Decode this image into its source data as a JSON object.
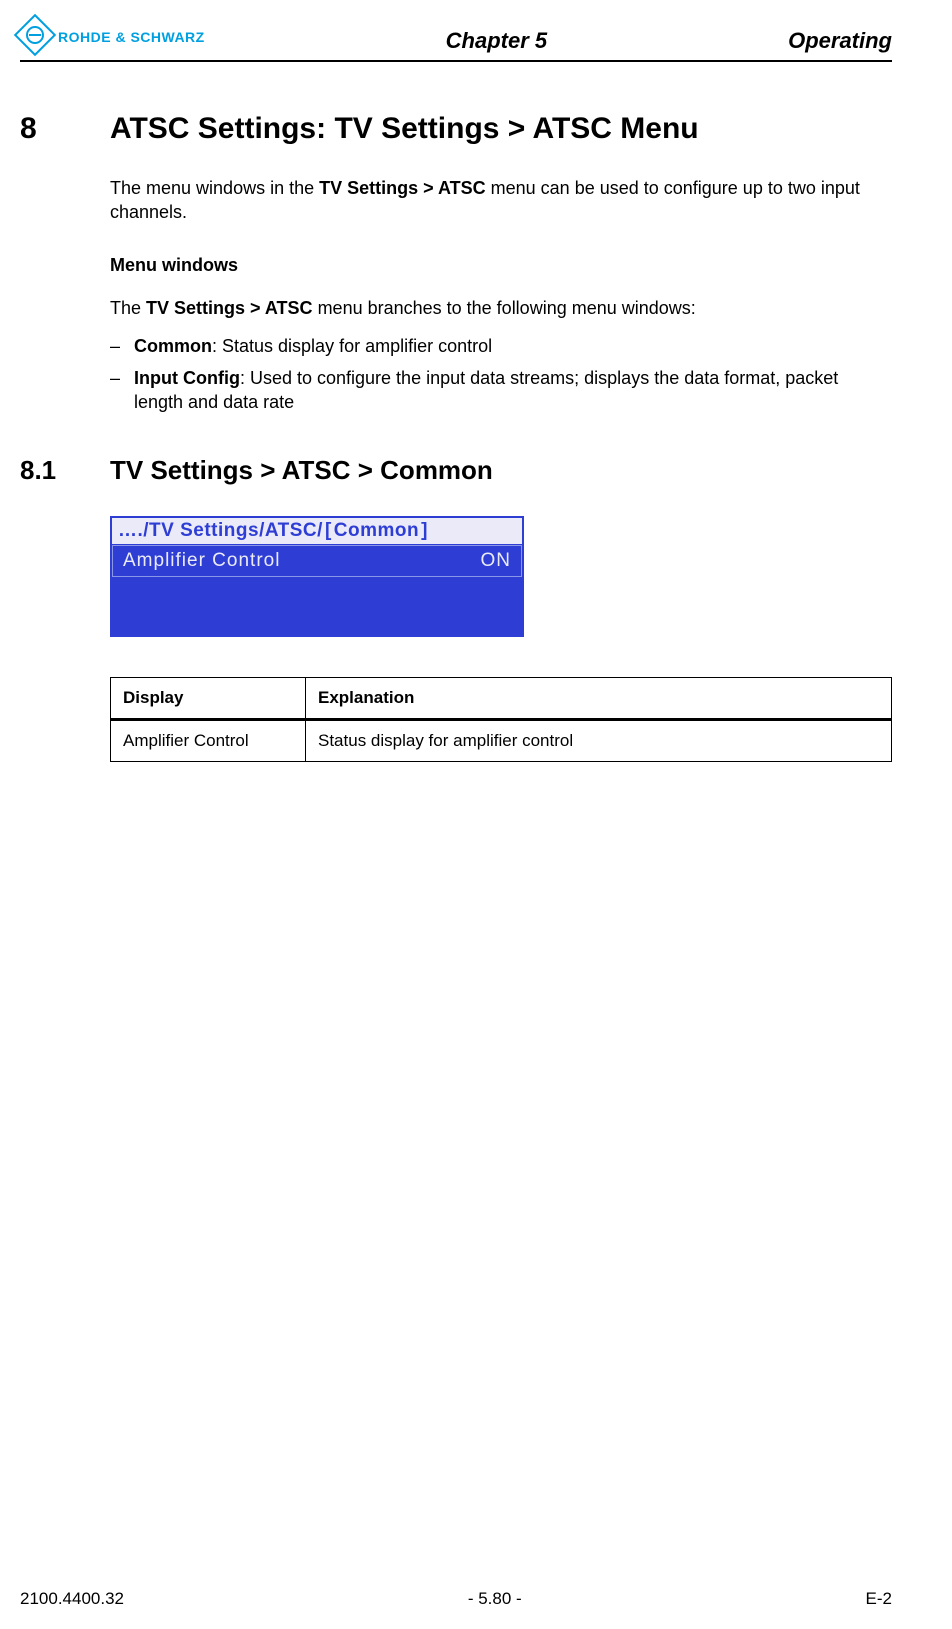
{
  "header": {
    "brand": "ROHDE & SCHWARZ",
    "chapter": "Chapter 5",
    "right": "Operating"
  },
  "section8": {
    "num": "8",
    "title": "ATSC Settings: TV Settings > ATSC Menu",
    "intro_pre": "The menu windows in the ",
    "intro_bold": "TV Settings > ATSC",
    "intro_post": " menu can be used to configure up to two input channels.",
    "menu_windows_head": "Menu windows",
    "branches_pre": "The ",
    "branches_bold": "TV Settings > ATSC",
    "branches_post": " menu branches to the following menu windows:",
    "items": [
      {
        "bold": "Common",
        "rest": ": Status display for amplifier control"
      },
      {
        "bold": "Input Config",
        "rest": ": Used to configure the input data streams; displays the data format, packet length and data rate"
      }
    ]
  },
  "section81": {
    "num": "8.1",
    "title": "TV Settings > ATSC > Common"
  },
  "screenshot": {
    "path": "…./TV Settings/ATSC/",
    "current": "Common",
    "row_label": "Amplifier Control",
    "row_value": "ON"
  },
  "table": {
    "head_display": "Display",
    "head_explanation": "Explanation",
    "rows": [
      {
        "display": "Amplifier Control",
        "explanation": "Status display for amplifier control"
      }
    ]
  },
  "footer": {
    "left": "2100.4400.32",
    "center": "- 5.80 -",
    "right": "E-2"
  }
}
